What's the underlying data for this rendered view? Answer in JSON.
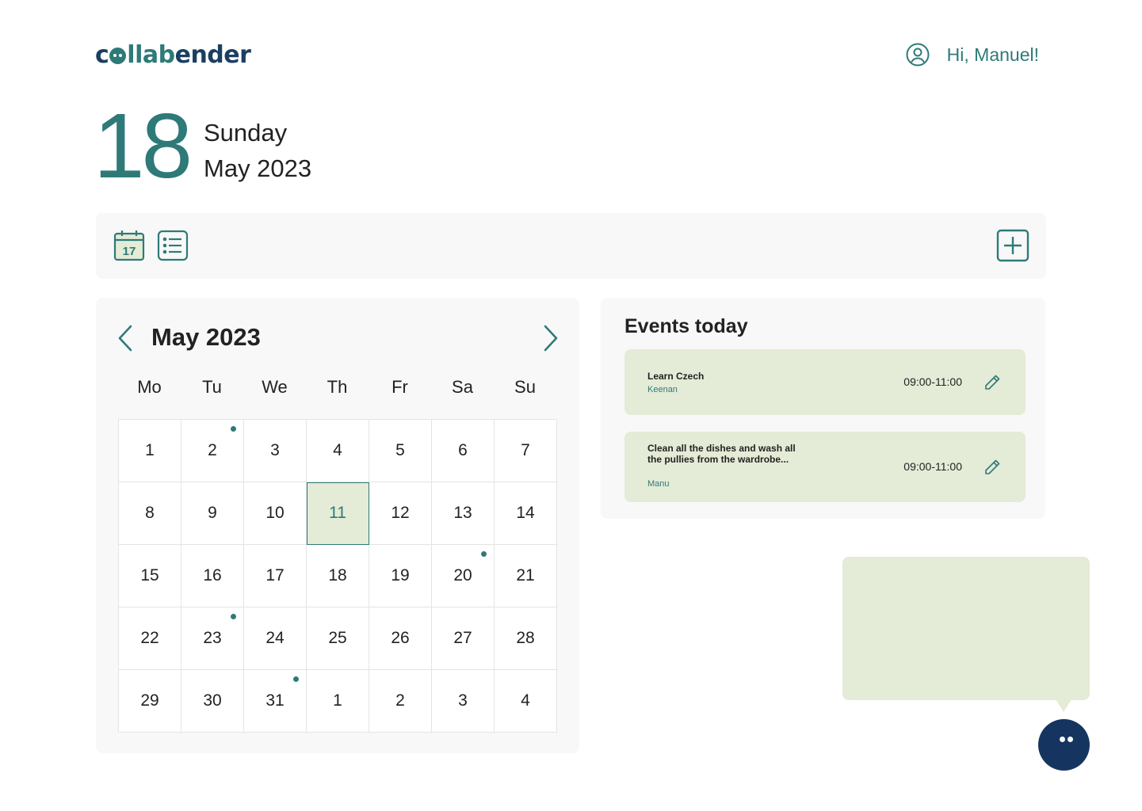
{
  "brand": {
    "logo_part1": "c",
    "logo_part2": "llab",
    "logo_part3": "ender"
  },
  "header": {
    "greeting": "Hi, Manuel!"
  },
  "today": {
    "day": "18",
    "weekday": "Sunday",
    "month_year": "May 2023"
  },
  "toolbar": {
    "calendar_icon_day": "17"
  },
  "calendar": {
    "title": "May 2023",
    "weekdays": [
      "Mo",
      "Tu",
      "We",
      "Th",
      "Fr",
      "Sa",
      "Su"
    ],
    "days": [
      {
        "label": "1"
      },
      {
        "label": "2",
        "dot": true
      },
      {
        "label": "3"
      },
      {
        "label": "4"
      },
      {
        "label": "5"
      },
      {
        "label": "6"
      },
      {
        "label": "7"
      },
      {
        "label": "8"
      },
      {
        "label": "9"
      },
      {
        "label": "10"
      },
      {
        "label": "11",
        "selected": true
      },
      {
        "label": "12"
      },
      {
        "label": "13"
      },
      {
        "label": "14"
      },
      {
        "label": "15"
      },
      {
        "label": "16"
      },
      {
        "label": "17"
      },
      {
        "label": "18"
      },
      {
        "label": "19"
      },
      {
        "label": "20",
        "dot": true
      },
      {
        "label": "21"
      },
      {
        "label": "22"
      },
      {
        "label": "23",
        "dot": true
      },
      {
        "label": "24"
      },
      {
        "label": "25"
      },
      {
        "label": "26"
      },
      {
        "label": "27"
      },
      {
        "label": "28"
      },
      {
        "label": "29"
      },
      {
        "label": "30"
      },
      {
        "label": "31",
        "dot": true
      },
      {
        "label": "1"
      },
      {
        "label": "2"
      },
      {
        "label": "3"
      },
      {
        "label": "4"
      }
    ]
  },
  "events": {
    "title": "Events today",
    "items": [
      {
        "title": "Learn Czech",
        "author": "Keenan",
        "time": "09:00-11:00"
      },
      {
        "title": "Clean all the dishes and wash all the pullies from the wardrobe...",
        "author": "Manu",
        "time": "09:00-11:00"
      }
    ]
  },
  "colors": {
    "accent": "#2e7a78",
    "navy": "#153560",
    "event_bg": "#e4ebd6",
    "panel_bg": "#f8f8f8"
  }
}
